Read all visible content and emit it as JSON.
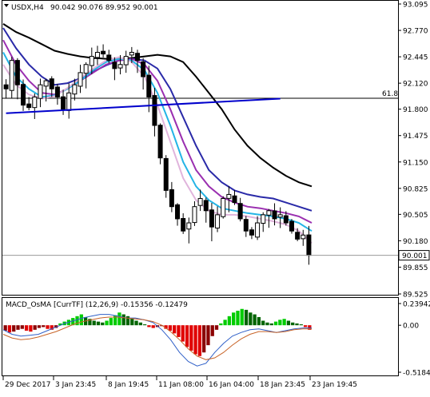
{
  "header": {
    "symbol": "USDX,H4",
    "ohlc": "90.042 90.076 89.952 90.001",
    "macd_label": "MACD_OsMA [CurrTF] (12,26,9) -0.15356 -0.12479"
  },
  "chart_data": [
    {
      "type": "candlestick",
      "title": "",
      "ylim": [
        89.525,
        93.095
      ],
      "y_ticks": [
        "93.095",
        "92.770",
        "92.445",
        "92.120",
        "91.800",
        "91.475",
        "91.150",
        "90.825",
        "90.505",
        "90.180",
        "89.855",
        "89.525"
      ],
      "x_ticks": [
        "29 Dec 2017",
        "3 Jan 23:45",
        "8 Jan 19:45",
        "11 Jan 08:00",
        "16 Jan 04:00",
        "18 Jan 23:45",
        "23 Jan 19:45"
      ],
      "current_price": "90.001",
      "fib_level": {
        "label": "61.8",
        "value": 91.935
      },
      "trendline": {
        "from": [
          0,
          91.75
        ],
        "to": [
          48,
          91.93
        ]
      },
      "close_path": [
        92.05,
        92.4,
        92.1,
        91.85,
        91.82,
        91.95,
        92.1,
        92.15,
        92.05,
        91.95,
        91.8,
        92.0,
        92.1,
        92.25,
        92.35,
        92.45,
        92.5,
        92.48,
        92.4,
        92.3,
        92.35,
        92.45,
        92.5,
        92.4,
        92.2,
        91.95,
        91.6,
        91.2,
        90.8,
        90.6,
        90.45,
        90.3,
        90.4,
        90.6,
        90.7,
        90.55,
        90.35,
        90.5,
        90.7,
        90.75,
        90.65,
        90.45,
        90.3,
        90.25,
        90.4,
        90.5,
        90.55,
        90.45,
        90.5,
        90.4,
        90.3,
        90.2,
        90.25,
        90.0
      ],
      "series": [
        {
          "name": "",
          "color": "#000000",
          "values": [
            92.85,
            92.75,
            92.68,
            92.6,
            92.52,
            92.48,
            92.45,
            92.43,
            92.42,
            92.42,
            92.43,
            92.45,
            92.47,
            92.45,
            92.38,
            92.2,
            92.0,
            91.8,
            91.55,
            91.35,
            91.2,
            91.08,
            90.98,
            90.9,
            90.85
          ]
        },
        {
          "name": "",
          "color": "#2a2aa8",
          "values": [
            92.8,
            92.55,
            92.35,
            92.2,
            92.1,
            92.12,
            92.18,
            92.26,
            92.34,
            92.4,
            92.42,
            92.4,
            92.3,
            92.05,
            91.7,
            91.35,
            91.05,
            90.9,
            90.8,
            90.75,
            90.72,
            90.7,
            90.65,
            90.6,
            90.55
          ]
        },
        {
          "name": "",
          "color": "#9a2fb0",
          "values": [
            92.65,
            92.35,
            92.15,
            92.0,
            91.98,
            92.05,
            92.15,
            92.25,
            92.35,
            92.4,
            92.42,
            92.35,
            92.15,
            91.8,
            91.4,
            91.05,
            90.85,
            90.72,
            90.65,
            90.6,
            90.58,
            90.55,
            90.52,
            90.48,
            90.4
          ]
        },
        {
          "name": "",
          "color": "#24b4e6",
          "values": [
            92.5,
            92.2,
            92.05,
            91.95,
            91.97,
            92.05,
            92.15,
            92.28,
            92.38,
            92.42,
            92.4,
            92.28,
            92.0,
            91.6,
            91.15,
            90.85,
            90.68,
            90.58,
            90.55,
            90.52,
            90.5,
            90.48,
            90.45,
            90.4,
            90.3
          ]
        },
        {
          "name": "",
          "color": "#e0b4dc",
          "values": [
            92.35,
            92.1,
            91.98,
            91.93,
            91.96,
            92.06,
            92.18,
            92.3,
            92.4,
            92.44,
            92.38,
            92.2,
            91.85,
            91.4,
            90.95,
            90.68,
            90.55,
            90.5,
            90.5,
            90.48,
            90.45,
            90.42,
            90.38,
            90.3,
            90.15
          ]
        }
      ]
    },
    {
      "type": "bar",
      "title": "MACD_OsMA [CurrTF] (12,26,9) -0.15356 -0.12479",
      "ylim": [
        -0.51843,
        0.23942
      ],
      "y_ticks": [
        "0.23942",
        "0.00",
        "-0.51843"
      ],
      "histogram": [
        -0.06,
        -0.08,
        -0.07,
        -0.05,
        -0.04,
        -0.06,
        -0.07,
        -0.05,
        -0.03,
        -0.02,
        -0.04,
        -0.05,
        -0.03,
        0.02,
        0.04,
        0.06,
        0.08,
        0.1,
        0.12,
        0.09,
        0.07,
        0.05,
        0.04,
        0.03,
        0.05,
        0.08,
        0.11,
        0.14,
        0.12,
        0.1,
        0.08,
        0.05,
        0.03,
        0.01,
        -0.02,
        -0.03,
        -0.02,
        -0.01,
        -0.04,
        -0.06,
        -0.09,
        -0.13,
        -0.18,
        -0.24,
        -0.28,
        -0.32,
        -0.34,
        -0.3,
        -0.22,
        -0.12,
        -0.05,
        0.02,
        0.06,
        0.1,
        0.14,
        0.16,
        0.18,
        0.17,
        0.14,
        0.12,
        0.09,
        0.05,
        0.03,
        0.02,
        0.04,
        0.06,
        0.07,
        0.05,
        0.03,
        0.02,
        0.01,
        -0.02,
        -0.05
      ],
      "series": [
        {
          "name": "",
          "color": "#3060c8",
          "values": [
            -0.05,
            -0.1,
            -0.12,
            -0.11,
            -0.1,
            -0.06,
            -0.02,
            0.02,
            0.05,
            0.08,
            0.1,
            0.12,
            0.12,
            0.1,
            0.08,
            0.08,
            0.06,
            0.03,
            -0.05,
            -0.16,
            -0.3,
            -0.4,
            -0.45,
            -0.42,
            -0.3,
            -0.2,
            -0.12,
            -0.08,
            -0.05,
            -0.04,
            -0.06,
            -0.08,
            -0.06,
            -0.04,
            -0.03,
            -0.03
          ]
        },
        {
          "name": "",
          "color": "#c86428",
          "values": [
            -0.1,
            -0.14,
            -0.16,
            -0.15,
            -0.13,
            -0.1,
            -0.07,
            -0.03,
            0.01,
            0.04,
            0.06,
            0.08,
            0.09,
            0.09,
            0.08,
            0.07,
            0.06,
            0.04,
            0.0,
            -0.07,
            -0.16,
            -0.26,
            -0.34,
            -0.38,
            -0.36,
            -0.3,
            -0.22,
            -0.15,
            -0.1,
            -0.07,
            -0.07,
            -0.08,
            -0.07,
            -0.05,
            -0.04,
            -0.04
          ]
        }
      ]
    }
  ]
}
